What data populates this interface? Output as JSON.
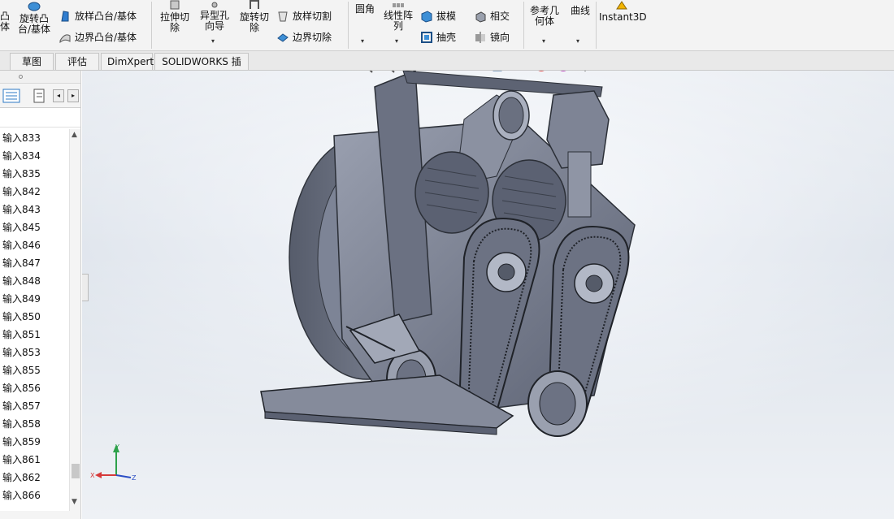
{
  "ribbon": {
    "revolve_boss": "旋转凸\n台/基体",
    "partial_left": "凸\n体",
    "loft_boss": "放样凸台/基体",
    "boundary_boss": "边界凸台/基体",
    "extruded_cut": "拉伸切\n除",
    "hole_wizard": "异型孔\n向导",
    "revolved_cut": "旋转切\n除",
    "lofted_cut": "放样切割",
    "boundary_cut": "边界切除",
    "fillet": "圆角",
    "linear_pattern": "线性阵\n列",
    "draft": "拔模",
    "shell": "抽壳",
    "intersect": "相交",
    "mirror": "镜向",
    "ref_geometry": "参考几\n何体",
    "curves": "曲线",
    "instant3d": "Instant3D"
  },
  "tabs": [
    "草图",
    "评估",
    "DimXpert",
    "SOLIDWORKS 插件"
  ],
  "tree": {
    "items": [
      "输入833",
      "输入834",
      "输入835",
      "输入842",
      "输入843",
      "输入845",
      "输入846",
      "输入847",
      "输入848",
      "输入849",
      "输入850",
      "输入851",
      "输入853",
      "输入855",
      "输入856",
      "输入857",
      "输入858",
      "输入859",
      "输入861",
      "输入862",
      "输入866"
    ]
  },
  "triad": {
    "x": "X",
    "y": "Y",
    "z": "Z"
  },
  "colors": {
    "accent": "#2b78c5",
    "model": "#7d8496",
    "viewport": "#e9edf3"
  }
}
